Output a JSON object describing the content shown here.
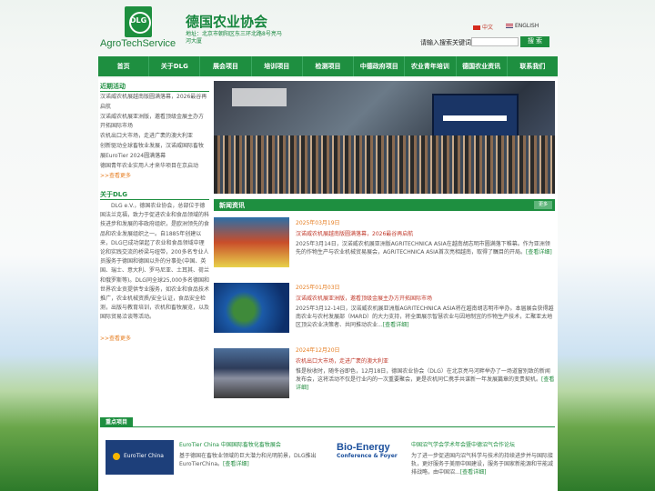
{
  "header": {
    "logo_text": "DLG",
    "brand": "AgroTechService",
    "title": "德国农业协会",
    "address": "地址：北京市朝阳区东三环北路8号亮马河大厦",
    "lang_cn": "中文",
    "lang_en": "ENGLISH",
    "search_label": "请输入搜索关键词",
    "search_button": "搜 索"
  },
  "nav": [
    "首页",
    "关于DLG",
    "展会项目",
    "培训项目",
    "检测项目",
    "中德政府项目",
    "农业青年培训",
    "德国农业资讯",
    "联系我们"
  ],
  "sidebar": {
    "recent_title": "近期活动",
    "recent_lines": [
      "汉诺威农机展越南版圆满落幕，2026最谷再",
      "启航",
      "汉诺威农机展亚洲版，邀看顶级金展主办方",
      "开拓国际市场",
      "农机出口大市场，走进广袤的澳大利亚",
      "创新驱动全球畜牧业发展，汉诺威国际畜牧",
      "展EuroTier 2024圆满落幕",
      "德国青年农业实用人才来华项目在京启动"
    ],
    "recent_more": ">>查看更多",
    "about_title": "关于DLG",
    "about_text": "DLG e.V.，德国农业协会，总部位于德国法兰克福，致力于促进农业和食品领域的科技进步和发展的非政府组织，是欧洲领先的食品和农业发展组织之一。自1885年创建以来，DLG已成功架起了农业和食品领域中理论和实践交流的桥梁与纽带，200多名专业人员服务于德国和德国以外的分事处(中国、英国、瑞士、意大利、罗马尼亚、土耳其、荷兰和俄罗斯等)。DLG同全球25,000多名德国和世界农业贡提供专业服务，如农业和食品技术推广，农业机械资质/安全认证，食品安全检测，出版与教育培训，农机和畜牧展览，以及国际贸易洽谈等活动。",
    "about_more": ">>查看更多"
  },
  "news": {
    "title": "新闻资讯",
    "more": "更多",
    "items": [
      {
        "date": "2025年03月19日",
        "title": "汉诺威农机展越南版圆满落幕，2026最谷再启航",
        "text": "2025年3月14日，汉诺威农机展亚洲版AGRITECHNICA ASIA在越南胡志明市圆满落下帷幕。作为亚洲领先的作物生产与农业机械贸易展会，AGRITECHNICA ASIA首次亮相越南，取得了瞩目的开局。",
        "more": "[查看详细]"
      },
      {
        "date": "2025年01月03日",
        "title": "汉诺威农机展亚洲版，邀看顶级金展主办方开拓国际市场",
        "text": "2025年3月12-14日，汉诺威农机展亚洲版AGRITECHNICA ASIA将在越南胡志明市举办。本届展会获得越南农业与农村发展部（MARD）的大力支持，将全面展示智慧农业与因地制宜的作物生产技术，汇聚亚太地区顶尖农业决策者、共同推动农业...",
        "more": "[查看详细]"
      },
      {
        "date": "2024年12月20日",
        "title": "农机出口大市场，走进广袤的澳大利亚",
        "text": "惟是秋收时，随冬谷即色，12月18日，德国农业协会（DLG）在北京亮马河畔举办了一场道窗别致的新闻发布会，这将活动不仅是行业内的一次重要聚会，更是农机同仁携手共谋新一年发展篇章的变贵契机。",
        "more": "[查看详细]"
      }
    ]
  },
  "highlights": {
    "title": "重点项目",
    "items": [
      {
        "title": "EuroTier China 中国国际畜牧化畜牧展会",
        "text": "基于德国在畜牧业领域的巨大潜力和光明前景，DLG推出EuroTierChina。",
        "more": "[查看详细]",
        "logo": "EuroTier China"
      },
      {
        "title": "中国沼气学会学术年会暨中德沼气合作论坛",
        "text": "为了进一步促进国内沼气科学与技术的持续进步并与国际接轨，更好服务于美丽中国建设，服务于国家新能源和节能减排战略，由中国沼...",
        "more": "[查看详细]",
        "logo_l1": "Bio-Energy",
        "logo_l2": "Conference & Foyer"
      }
    ]
  },
  "colors": {
    "primary": "#1e8f40",
    "accent": "#e67e22",
    "title_red": "#c0392b"
  }
}
